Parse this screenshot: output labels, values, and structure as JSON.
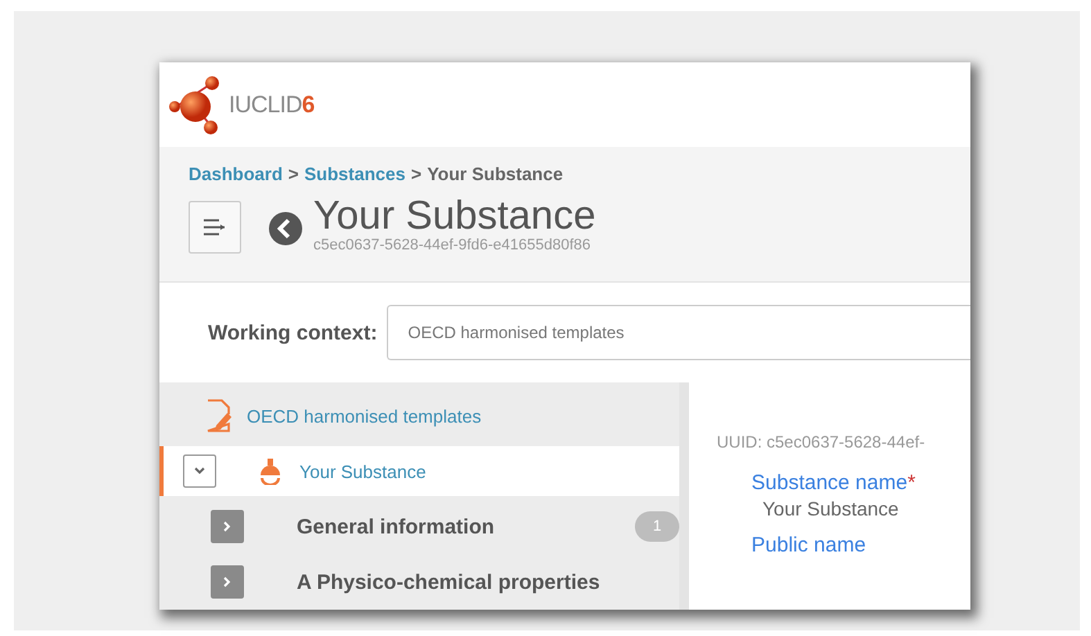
{
  "app": {
    "logo_text": "IUCLID",
    "logo_version": "6"
  },
  "breadcrumb": [
    {
      "label": "Dashboard",
      "kind": "link"
    },
    {
      "label": "Substances",
      "kind": "link"
    },
    {
      "label": "Your Substance",
      "kind": "current"
    }
  ],
  "breadcrumb_separator": ">",
  "page": {
    "title": "Your Substance",
    "subtitle": "c5ec0637-5628-44ef-9fd6-e41655d80f86"
  },
  "working_context": {
    "label": "Working context:",
    "value": "OECD harmonised templates"
  },
  "sidebar": {
    "items": [
      {
        "kind": "template",
        "label": "OECD harmonised templates",
        "selected": false
      },
      {
        "kind": "substance",
        "label": "Your Substance",
        "selected": true,
        "expanded": true,
        "children": [
          {
            "kind": "section",
            "label": "General information",
            "selected": false,
            "expanded": false,
            "badge": "1"
          },
          {
            "kind": "section",
            "label": "A Physico-chemical properties",
            "selected": false,
            "expanded": false
          }
        ]
      }
    ]
  },
  "content": {
    "uuid": "UUID: c5ec0637-5628-44ef-",
    "fields": [
      {
        "label": "Substance name",
        "required_mark": "*",
        "value": "Your Substance"
      },
      {
        "label": "Public name"
      }
    ]
  }
}
